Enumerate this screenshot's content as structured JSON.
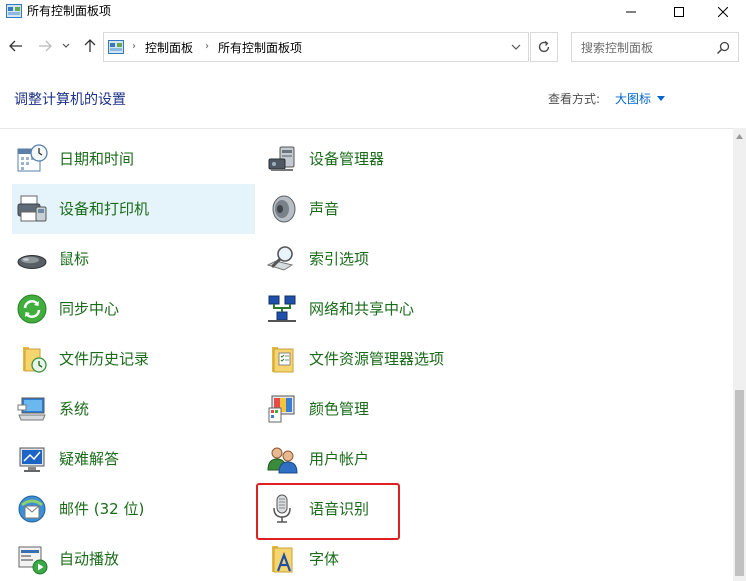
{
  "window": {
    "title": "所有控制面板项"
  },
  "address": {
    "crumbs": [
      "控制面板",
      "所有控制面板项"
    ]
  },
  "search": {
    "placeholder": "搜索控制面板"
  },
  "header": {
    "title": "调整计算机的设置",
    "view_by_label": "查看方式:",
    "view_by_value": "大图标"
  },
  "items": {
    "left": [
      {
        "label": "日期和时间",
        "icon": "calendar-clock-icon"
      },
      {
        "label": "设备和打印机",
        "icon": "printer-icon"
      },
      {
        "label": "鼠标",
        "icon": "mouse-icon"
      },
      {
        "label": "同步中心",
        "icon": "sync-icon"
      },
      {
        "label": "文件历史记录",
        "icon": "file-history-icon"
      },
      {
        "label": "系统",
        "icon": "computer-icon"
      },
      {
        "label": "疑难解答",
        "icon": "troubleshoot-icon"
      },
      {
        "label": "邮件 (32 位)",
        "icon": "mail-icon"
      },
      {
        "label": "自动播放",
        "icon": "autoplay-icon"
      }
    ],
    "right": [
      {
        "label": "设备管理器",
        "icon": "device-manager-icon"
      },
      {
        "label": "声音",
        "icon": "speaker-icon"
      },
      {
        "label": "索引选项",
        "icon": "index-search-icon"
      },
      {
        "label": "网络和共享中心",
        "icon": "network-icon"
      },
      {
        "label": "文件资源管理器选项",
        "icon": "folder-options-icon"
      },
      {
        "label": "颜色管理",
        "icon": "color-management-icon"
      },
      {
        "label": "用户帐户",
        "icon": "users-icon"
      },
      {
        "label": "语音识别",
        "icon": "microphone-icon"
      },
      {
        "label": "字体",
        "icon": "fonts-icon"
      }
    ]
  },
  "colors": {
    "item_text": "#1a6b1a",
    "title_text": "#1e3287",
    "link": "#0066cc",
    "highlight_bg": "#e5f3fb",
    "annotation_box": "#e02020"
  }
}
